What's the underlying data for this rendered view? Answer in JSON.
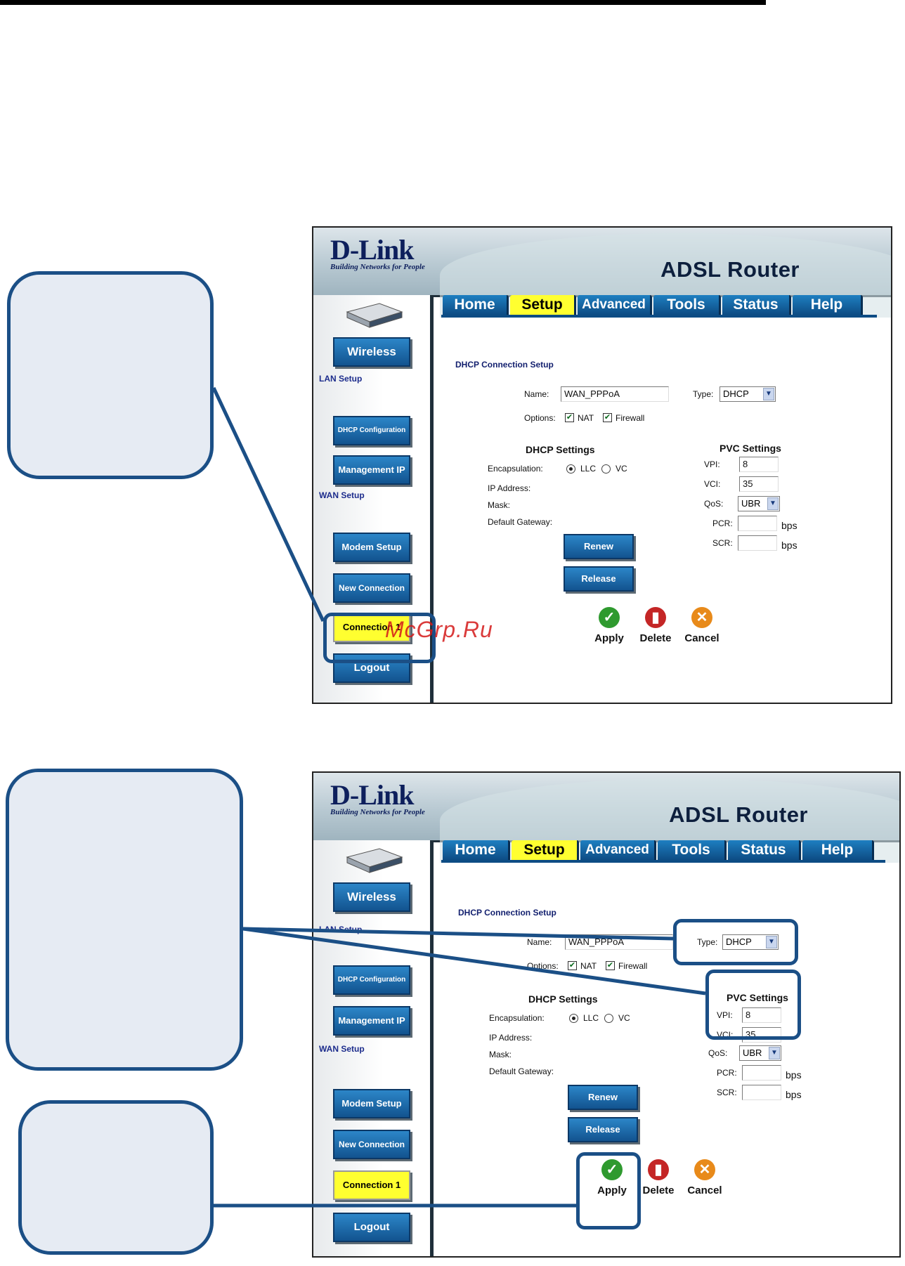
{
  "brand": {
    "name": "D-Link",
    "tagline": "Building Networks for People"
  },
  "product": "ADSL Router",
  "tabs": [
    "Home",
    "Setup",
    "Advanced",
    "Tools",
    "Status",
    "Help"
  ],
  "active_tab": "Setup",
  "sidebar": {
    "wireless": "Wireless",
    "lan_setup": "LAN Setup",
    "dhcp_config": "DHCP Configuration",
    "management_ip": "Management IP",
    "wan_setup": "WAN Setup",
    "modem_setup": "Modem Setup",
    "new_connection": "New Connection",
    "connection": "Connection 1",
    "logout": "Logout"
  },
  "form": {
    "title": "DHCP Connection Setup",
    "name_label": "Name:",
    "name_value": "WAN_PPPoA",
    "type_label": "Type:",
    "type_value": "DHCP",
    "options_label": "Options:",
    "nat": "NAT",
    "firewall": "Firewall",
    "dhcp_settings": "DHCP Settings",
    "encapsulation": "Encapsulation:",
    "llc": "LLC",
    "vc": "VC",
    "ip_address": "IP Address:",
    "mask": "Mask:",
    "gateway": "Default Gateway:",
    "renew": "Renew",
    "release": "Release",
    "pvc_settings": "PVC Settings",
    "vpi_label": "VPI:",
    "vpi_value": "8",
    "vci_label": "VCI:",
    "vci_value": "35",
    "qos_label": "QoS:",
    "qos_value": "UBR",
    "pcr_label": "PCR:",
    "scr_label": "SCR:",
    "bps": "bps",
    "apply": "Apply",
    "delete": "Delete",
    "cancel": "Cancel"
  },
  "watermark": "McGrp.Ru",
  "colors": {
    "accent_blue": "#1b4f86",
    "button_blue": "#12538f",
    "active_yellow": "#ffff30",
    "callout_fill": "#e6ebf3"
  }
}
